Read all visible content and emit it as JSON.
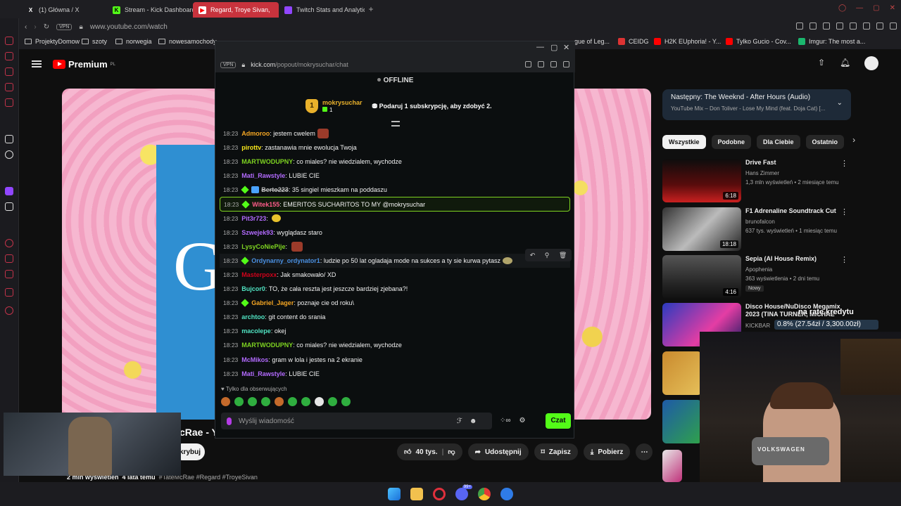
{
  "browser": {
    "tabs": [
      {
        "label": "(1) Główna / X",
        "icon": "x-icon",
        "color": "#000000"
      },
      {
        "label": "Stream - Kick Dashboard",
        "icon": "kick-icon",
        "color": "#53fc18"
      },
      {
        "label": "Regard, Troye Sivan,",
        "icon": "youtube-icon",
        "color": "#ff0000",
        "active": true
      },
      {
        "label": "Twitch Stats and Analytics",
        "icon": "twitch-stats-icon",
        "color": "#9146ff"
      }
    ],
    "new_tab": "+",
    "vpn_label": "VPN",
    "url": "www.youtube.com/watch",
    "bookmarks": [
      {
        "label": "ProjektyDomow",
        "icon": "folder-icon"
      },
      {
        "label": "szoty",
        "icon": "folder-icon"
      },
      {
        "label": "norwegia",
        "icon": "folder-icon"
      },
      {
        "label": "nowesamochody",
        "icon": "folder-icon"
      },
      {
        "label": "gue of Leg...",
        "icon": "league-icon"
      },
      {
        "label": "CEIDG",
        "icon": "ceidg-icon"
      },
      {
        "label": "H2K EUphoria! - Y...",
        "icon": "youtube-icon"
      },
      {
        "label": "Tylko Gucio - Cov...",
        "icon": "youtube-icon"
      },
      {
        "label": "Imgur: The most a...",
        "icon": "imgur-icon"
      }
    ]
  },
  "youtube": {
    "logo_text": "Premium",
    "region": "PL",
    "video_title": "cRae - Y",
    "subscribe_label": "krybuj",
    "actions": {
      "likes": "40 tys.",
      "share": "Udostępnij",
      "save": "Zapisz",
      "download": "Pobierz"
    },
    "meta_views": "2 mln wyświetleń",
    "meta_age": "4 lata temu",
    "meta_tags": "#TateMcRae #Regard #TroyeSivan",
    "up_next": {
      "title": "Następny: The Weeknd - After Hours (Audio)",
      "subtitle": "YouTube Mix – Don Toliver - Lose My Mind (feat. Doja Cat) [..."
    },
    "chips": [
      "Wszystkie",
      "Podobne",
      "Dla Ciebie",
      "Ostatnio"
    ],
    "recommendations": [
      {
        "title": "Drive Fast",
        "channel": "Hans Zimmer",
        "views": "1,3 mln wyświetleń • 2 miesiące temu",
        "duration": "6:18",
        "badge": ""
      },
      {
        "title": "F1 Adrenaline Soundtrack Cut",
        "channel": "brunofalcon",
        "views": "637 tys. wyświetleń • 1 miesiąc temu",
        "duration": "18:18",
        "badge": ""
      },
      {
        "title": "Sepia (AI House Remix)",
        "channel": "Apophenia",
        "views": "363 wyświetlenia • 2 dni temu",
        "duration": "4:16",
        "badge": "Nowy"
      },
      {
        "title": "Disco House/NuDisco Megamix 2023 (TINA TURNER, MICHAE",
        "channel": "KICKBAR",
        "views": "",
        "duration": "",
        "badge": ""
      }
    ]
  },
  "overlay": {
    "credit_label": "na ratę kredytu",
    "credit_value": "0.8% (27.54zł / 3,300.00zł)",
    "webcam_car_text": "VOLKSWAGEN"
  },
  "kick": {
    "vpn_label": "VPN",
    "url_domain": "kick.com",
    "url_path": "/popout/mokrysuchar/chat",
    "status": "OFFLINE",
    "pinned": {
      "rank": "1",
      "user": "mokrysuchar",
      "count": "1",
      "cta": "Podaruj 1 subskrypcję, aby zdobyć 2."
    },
    "messages": [
      {
        "time": "18:23",
        "user": "Admoroo",
        "color": "#f5a623",
        "text": "jestem cwelem",
        "emote": "brown"
      },
      {
        "time": "18:23",
        "user": "pirottv",
        "color": "#f8e71c",
        "text": "zastanawia mnie ewolucja Twoja"
      },
      {
        "time": "18:23",
        "user": "MARTWODUPNY",
        "color": "#7ed321",
        "text": "co miales? nie wiedzialem, wychodze"
      },
      {
        "time": "18:23",
        "user": "Mati_Rawstyle",
        "color": "#b36bff",
        "text": "LUBIE CIE"
      },
      {
        "time": "18:23",
        "user": "Berto223",
        "color": "#bbbbbb",
        "text": "35 singiel mieszkam na poddaszu",
        "badges": true,
        "struck": true
      },
      {
        "time": "18:23",
        "user": "Witek155",
        "color": "#ff5c8a",
        "text": "EMERITOS SUCHARITOS TO MY @mokrysuchar",
        "badges": true,
        "highlight": true
      },
      {
        "time": "18:23",
        "user": "Pit3r723",
        "color": "#b36bff",
        "text": "",
        "emote": "yellow"
      },
      {
        "time": "18:23",
        "user": "Szwejek93",
        "color": "#b36bff",
        "text": "wyglądasz staro"
      },
      {
        "time": "18:23",
        "user": "LysyCoNiePije",
        "color": "#7ed321",
        "text": "",
        "emote": "brown"
      },
      {
        "time": "18:23",
        "user": "Ordynarny_ordynator1",
        "color": "#4a90e2",
        "text": "ludzie po 50 lat ogladaja mode na sukces a ty sie kurwa pytasz",
        "badges": true,
        "emote": "gold"
      },
      {
        "time": "18:23",
        "user": "Masterpoxx",
        "color": "#d0021b",
        "text": "Jak smakowało/ XD"
      },
      {
        "time": "18:23",
        "user": "Bujcor0",
        "color": "#50e3c2",
        "text": "TO, że cała reszta jest jeszcze bardziej zjebana?!"
      },
      {
        "time": "18:23",
        "user": "Gabriel_Jager",
        "color": "#f5a623",
        "text": "poznaje cie od roku\\",
        "badges": true
      },
      {
        "time": "18:23",
        "user": "archtoo",
        "color": "#50e3c2",
        "text": "git content do srania"
      },
      {
        "time": "18:23",
        "user": "macolepe",
        "color": "#50e3c2",
        "text": "okej"
      },
      {
        "time": "18:23",
        "user": "MARTWODUPNY",
        "color": "#7ed321",
        "text": "co miales? nie wiedzialem, wychodze"
      },
      {
        "time": "18:23",
        "user": "McMikos",
        "color": "#b36bff",
        "text": "gram w lola i jestes na 2 ekranie"
      },
      {
        "time": "18:23",
        "user": "Mati_Rawstyle",
        "color": "#b36bff",
        "text": "LUBIE CIE"
      }
    ],
    "followers_only": "Tylko dla obserwujących",
    "input_placeholder": "Wyślij wiadomość",
    "send_label": "Czat"
  },
  "taskbar": {
    "discord_count": "99+"
  }
}
